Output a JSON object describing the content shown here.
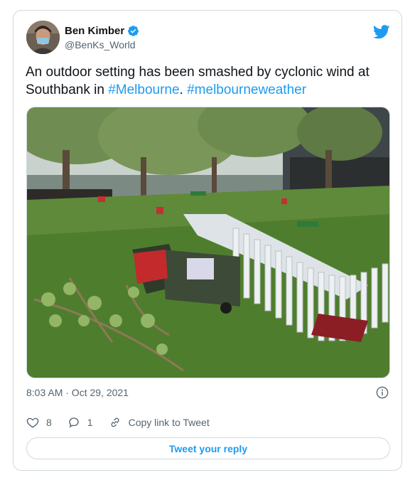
{
  "tweet": {
    "author_name": "Ben Kimber",
    "author_handle": "@BenKs_World",
    "text_before": "An outdoor setting has been smashed by cyclonic wind at Southbank in ",
    "hashtag1": "#Melbourne",
    "text_middle": ". ",
    "hashtag2": "#melbourneweather",
    "timestamp": "8:03 AM · Oct 29, 2021"
  },
  "actions": {
    "like_count": "8",
    "reply_count": "1",
    "copy_link_label": "Copy link to Tweet",
    "reply_button_label": "Tweet your reply"
  },
  "colors": {
    "accent": "#1d9bf0",
    "border": "#cfd9de",
    "secondary_text": "#536471"
  },
  "icons": [
    "verified-badge-icon",
    "twitter-bird-icon",
    "info-icon",
    "heart-icon",
    "reply-bubble-icon",
    "link-icon"
  ]
}
